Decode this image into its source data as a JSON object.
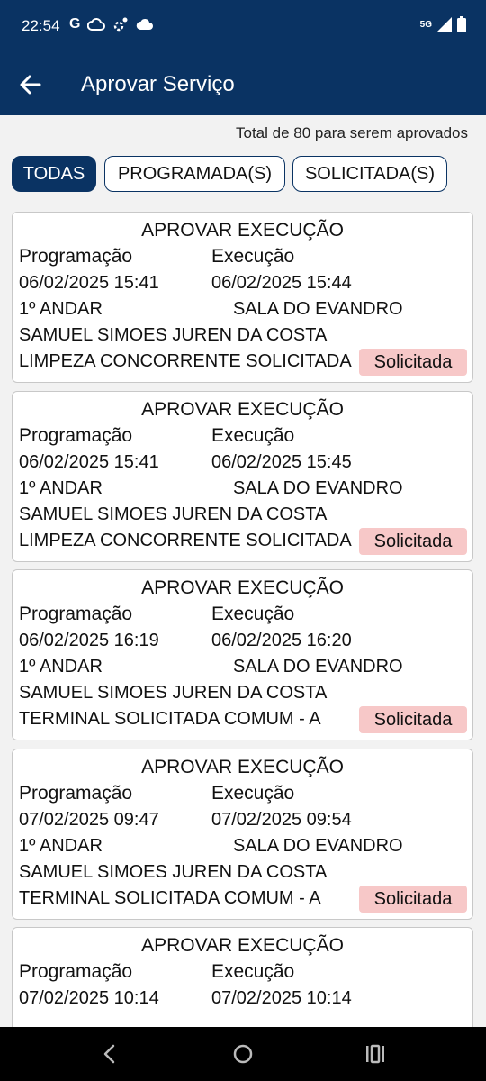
{
  "status_bar": {
    "time": "22:54",
    "notification_icons": [
      "G",
      "cloud-icon",
      "settings-icon",
      "cloud-filled-icon"
    ],
    "network": "5G"
  },
  "app_bar": {
    "title": "Aprovar Serviço"
  },
  "summary": {
    "total_text": "Total de 80 para serem aprovados"
  },
  "filters": [
    {
      "label": "TODAS",
      "active": true
    },
    {
      "label": "PROGRAMADA(S)",
      "active": false
    },
    {
      "label": "SOLICITADA(S)",
      "active": false
    }
  ],
  "cards": [
    {
      "title": "APROVAR EXECUÇÃO",
      "prog_label": "Programação",
      "exec_label": "Execução",
      "prog_datetime": "06/02/2025  15:41",
      "exec_datetime": "06/02/2025  15:44",
      "floor": "1º ANDAR",
      "room": "SALA DO EVANDRO",
      "person": "SAMUEL SIMOES JUREN DA COSTA",
      "service": "LIMPEZA CONCORRENTE SOLICITADA",
      "status": "Solicitada"
    },
    {
      "title": "APROVAR EXECUÇÃO",
      "prog_label": "Programação",
      "exec_label": "Execução",
      "prog_datetime": "06/02/2025  15:41",
      "exec_datetime": "06/02/2025  15:45",
      "floor": "1º ANDAR",
      "room": "SALA DO EVANDRO",
      "person": "SAMUEL SIMOES JUREN DA COSTA",
      "service": "LIMPEZA CONCORRENTE SOLICITADA",
      "status": "Solicitada"
    },
    {
      "title": "APROVAR EXECUÇÃO",
      "prog_label": "Programação",
      "exec_label": "Execução",
      "prog_datetime": "06/02/2025  16:19",
      "exec_datetime": "06/02/2025  16:20",
      "floor": "1º ANDAR",
      "room": "SALA DO EVANDRO",
      "person": "SAMUEL SIMOES JUREN DA COSTA",
      "service": "TERMINAL SOLICITADA COMUM - A",
      "status": "Solicitada"
    },
    {
      "title": "APROVAR EXECUÇÃO",
      "prog_label": "Programação",
      "exec_label": "Execução",
      "prog_datetime": "07/02/2025  09:47",
      "exec_datetime": "07/02/2025  09:54",
      "floor": "1º ANDAR",
      "room": "SALA DO EVANDRO",
      "person": "SAMUEL SIMOES JUREN DA COSTA",
      "service": "TERMINAL SOLICITADA COMUM - A",
      "status": "Solicitada"
    },
    {
      "title": "APROVAR EXECUÇÃO",
      "prog_label": "Programação",
      "exec_label": "Execução",
      "prog_datetime": "07/02/2025  10:14",
      "exec_datetime": "07/02/2025  10:14"
    }
  ],
  "colors": {
    "primary": "#0a3363",
    "badge_bg": "#f7c8c8"
  }
}
